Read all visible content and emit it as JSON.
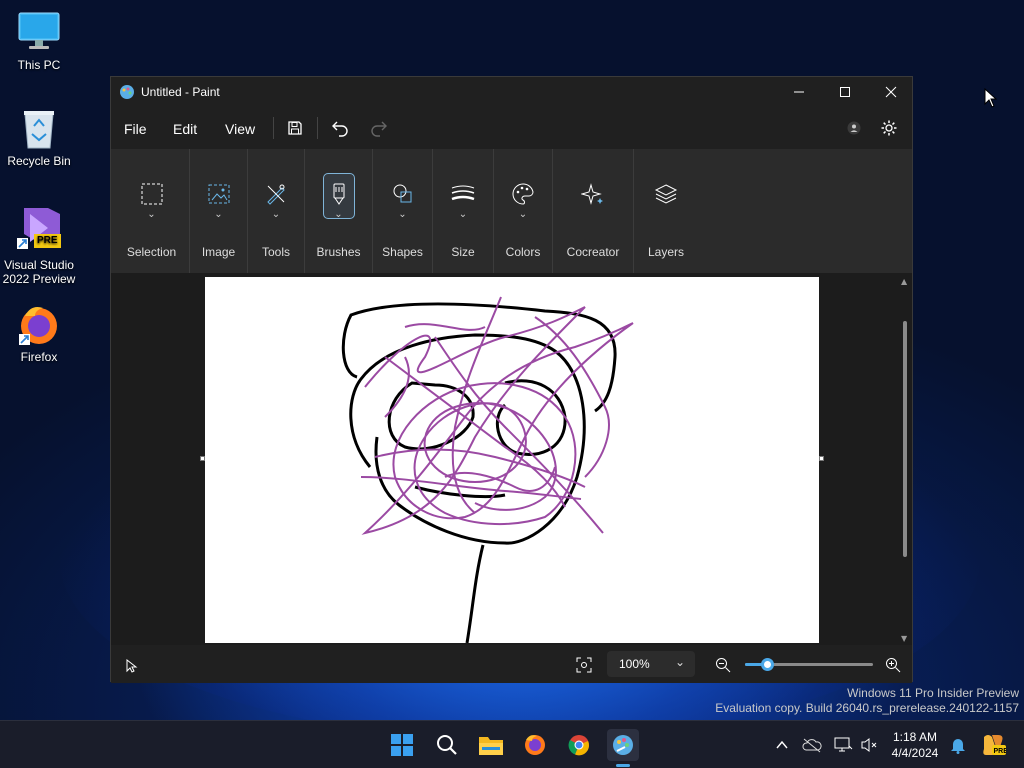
{
  "desktop": {
    "icons": [
      {
        "label": "This PC",
        "icon": "monitor-icon"
      },
      {
        "label": "Recycle Bin",
        "icon": "recycle-bin-icon"
      },
      {
        "label": "Visual Studio 2022 Preview",
        "icon": "visual-studio-icon",
        "badge": "PRE"
      },
      {
        "label": "Firefox",
        "icon": "firefox-icon"
      }
    ]
  },
  "window": {
    "title": "Untitled - Paint",
    "menu": {
      "file": "File",
      "edit": "Edit",
      "view": "View"
    },
    "ribbon": {
      "groups": [
        {
          "label": "Selection",
          "icon": "selection-icon"
        },
        {
          "label": "Image",
          "icon": "image-icon"
        },
        {
          "label": "Tools",
          "icon": "tools-icon"
        },
        {
          "label": "Brushes",
          "icon": "brush-icon",
          "active": true
        },
        {
          "label": "Shapes",
          "icon": "shapes-icon"
        },
        {
          "label": "Size",
          "icon": "size-icon"
        },
        {
          "label": "Colors",
          "icon": "palette-icon"
        },
        {
          "label": "Cocreator",
          "icon": "sparkle-icon"
        },
        {
          "label": "Layers",
          "icon": "layers-icon"
        }
      ]
    },
    "status": {
      "zoom": "100%",
      "zoom_level": 0.17
    },
    "colors": {
      "accent": "#4aa8e8",
      "ink_black": "#000000",
      "ink_purple": "#9b4aa3"
    }
  },
  "watermark": {
    "line1": "Windows 11 Pro Insider Preview",
    "line2": "Evaluation copy. Build 26040.rs_prerelease.240122-1157"
  },
  "taskbar": {
    "time": "1:18 AM",
    "date": "4/4/2024",
    "apps": [
      "start-icon",
      "search-icon",
      "file-explorer-icon",
      "firefox-icon",
      "chrome-icon",
      "paint-icon"
    ]
  }
}
